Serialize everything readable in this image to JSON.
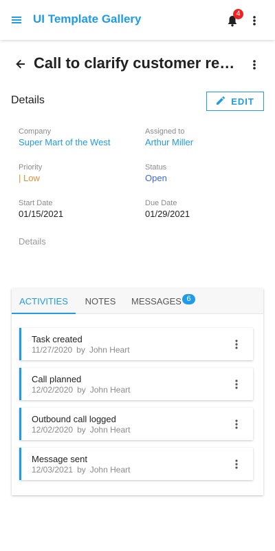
{
  "app": {
    "title": "UI Template Gallery",
    "notification_count": "4",
    "accent": "#1e9bea"
  },
  "page": {
    "title": "Call to clarify customer requ..."
  },
  "details": {
    "section_title": "Details",
    "edit_label": "EDIT",
    "company_label": "Company",
    "company_value": "Super Mart of the West",
    "assigned_label": "Assigned to",
    "assigned_value": "Arthur Miller",
    "priority_label": "Priority",
    "priority_value": "| Low",
    "status_label": "Status",
    "status_value": "Open",
    "start_label": "Start Date",
    "start_value": "01/15/2021",
    "due_label": "Due Date",
    "due_value": "01/29/2021",
    "details_label": "Details"
  },
  "tabs": {
    "activities": "ACTIVITIES",
    "notes": "NOTES",
    "messages": "MESSAGES",
    "messages_count": "6"
  },
  "activities": [
    {
      "title": "Task created",
      "date": "11/27/2020",
      "by": "by",
      "author": "John Heart"
    },
    {
      "title": "Call planned",
      "date": "12/02/2020",
      "by": "by",
      "author": "John Heart"
    },
    {
      "title": "Outbound call logged",
      "date": "12/02/2020",
      "by": "by",
      "author": "John Heart"
    },
    {
      "title": "Message sent",
      "date": "12/03/2021",
      "by": "by",
      "author": "John Heart"
    }
  ]
}
